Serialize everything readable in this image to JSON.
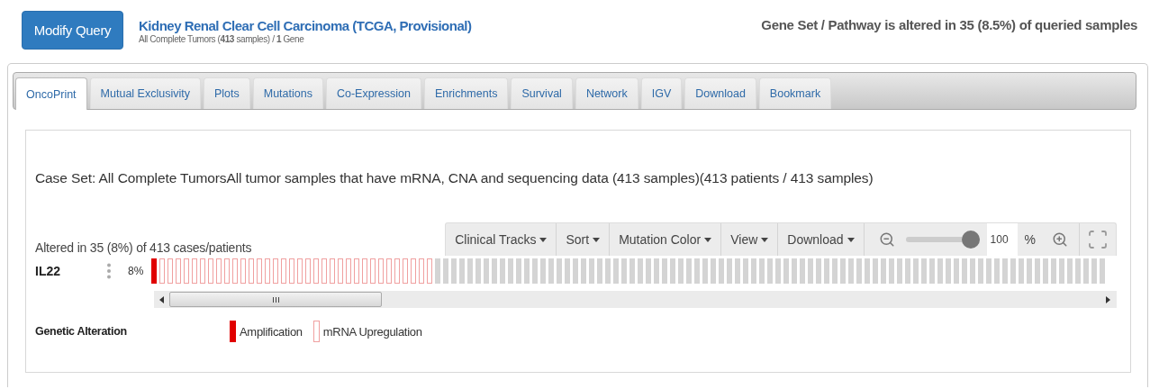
{
  "header": {
    "modify_button": "Modify Query",
    "study_title": "Kidney Renal Clear Cell Carcinoma (TCGA, Provisional)",
    "study_subtitle": "All Complete Tumors (**413** samples) / **1** Gene",
    "altered_summary": "Gene Set / Pathway is altered in 35 (8.5%) of queried samples"
  },
  "tabs": [
    {
      "label": "OncoPrint",
      "selected": true
    },
    {
      "label": "Mutual Exclusivity",
      "selected": false
    },
    {
      "label": "Plots",
      "selected": false
    },
    {
      "label": "Mutations",
      "selected": false
    },
    {
      "label": "Co-Expression",
      "selected": false
    },
    {
      "label": "Enrichments",
      "selected": false
    },
    {
      "label": "Survival",
      "selected": false
    },
    {
      "label": "Network",
      "selected": false
    },
    {
      "label": "IGV",
      "selected": false
    },
    {
      "label": "Download",
      "selected": false
    },
    {
      "label": "Bookmark",
      "selected": false
    }
  ],
  "case_set": "Case Set: All Complete TumorsAll tumor samples that have mRNA, CNA and sequencing data (413 samples)(413 patients / 413 samples)",
  "oncoprint": {
    "altered_text": "Altered in 35 (8%) of 413 cases/patients",
    "toolbar": {
      "menus": [
        "Clinical Tracks",
        "Sort",
        "Mutation Color",
        "View",
        "Download"
      ],
      "zoom": {
        "level": 1,
        "value": "100",
        "unit": "%"
      }
    },
    "track": {
      "gene": "IL22",
      "percent": "8%",
      "cells": [
        {
          "kind": "amp"
        },
        {
          "kind": "mrna_up"
        },
        {
          "kind": "mrna_up"
        },
        {
          "kind": "mrna_up"
        },
        {
          "kind": "mrna_up"
        },
        {
          "kind": "mrna_up"
        },
        {
          "kind": "mrna_up"
        },
        {
          "kind": "mrna_up"
        },
        {
          "kind": "mrna_up"
        },
        {
          "kind": "mrna_up"
        },
        {
          "kind": "mrna_up"
        },
        {
          "kind": "mrna_up"
        },
        {
          "kind": "mrna_up"
        },
        {
          "kind": "mrna_up"
        },
        {
          "kind": "mrna_up"
        },
        {
          "kind": "mrna_up"
        },
        {
          "kind": "mrna_up"
        },
        {
          "kind": "mrna_up"
        },
        {
          "kind": "mrna_up"
        },
        {
          "kind": "mrna_up"
        },
        {
          "kind": "mrna_up"
        },
        {
          "kind": "mrna_up"
        },
        {
          "kind": "mrna_up"
        },
        {
          "kind": "mrna_up"
        },
        {
          "kind": "mrna_up"
        },
        {
          "kind": "mrna_up"
        },
        {
          "kind": "mrna_up"
        },
        {
          "kind": "mrna_up"
        },
        {
          "kind": "mrna_up"
        },
        {
          "kind": "mrna_up"
        },
        {
          "kind": "mrna_up"
        },
        {
          "kind": "mrna_up"
        },
        {
          "kind": "mrna_up"
        },
        {
          "kind": "mrna_up"
        },
        {
          "kind": "mrna_up"
        },
        {
          "kind": "none"
        },
        {
          "kind": "none"
        },
        {
          "kind": "none"
        },
        {
          "kind": "none"
        },
        {
          "kind": "none"
        },
        {
          "kind": "none"
        },
        {
          "kind": "none"
        },
        {
          "kind": "none"
        },
        {
          "kind": "none"
        },
        {
          "kind": "none"
        },
        {
          "kind": "none"
        },
        {
          "kind": "none"
        },
        {
          "kind": "none"
        },
        {
          "kind": "none"
        },
        {
          "kind": "none"
        },
        {
          "kind": "none"
        },
        {
          "kind": "none"
        },
        {
          "kind": "none"
        },
        {
          "kind": "none"
        },
        {
          "kind": "none"
        },
        {
          "kind": "none"
        },
        {
          "kind": "none"
        },
        {
          "kind": "none"
        },
        {
          "kind": "none"
        },
        {
          "kind": "none"
        },
        {
          "kind": "none"
        },
        {
          "kind": "none"
        },
        {
          "kind": "none"
        },
        {
          "kind": "none"
        },
        {
          "kind": "none"
        },
        {
          "kind": "none"
        },
        {
          "kind": "none"
        },
        {
          "kind": "none"
        },
        {
          "kind": "none"
        },
        {
          "kind": "none"
        },
        {
          "kind": "none"
        },
        {
          "kind": "none"
        },
        {
          "kind": "none"
        },
        {
          "kind": "none"
        },
        {
          "kind": "none"
        },
        {
          "kind": "none"
        },
        {
          "kind": "none"
        },
        {
          "kind": "none"
        },
        {
          "kind": "none"
        },
        {
          "kind": "none"
        },
        {
          "kind": "none"
        },
        {
          "kind": "none"
        },
        {
          "kind": "none"
        },
        {
          "kind": "none"
        },
        {
          "kind": "none"
        },
        {
          "kind": "none"
        },
        {
          "kind": "none"
        },
        {
          "kind": "none"
        },
        {
          "kind": "none"
        },
        {
          "kind": "none"
        },
        {
          "kind": "none"
        },
        {
          "kind": "none"
        },
        {
          "kind": "none"
        },
        {
          "kind": "none"
        },
        {
          "kind": "none"
        },
        {
          "kind": "none"
        },
        {
          "kind": "none"
        },
        {
          "kind": "none"
        },
        {
          "kind": "none"
        },
        {
          "kind": "none"
        },
        {
          "kind": "none"
        },
        {
          "kind": "none"
        },
        {
          "kind": "none"
        },
        {
          "kind": "none"
        },
        {
          "kind": "none"
        },
        {
          "kind": "none"
        },
        {
          "kind": "none"
        },
        {
          "kind": "none"
        },
        {
          "kind": "none"
        },
        {
          "kind": "none"
        },
        {
          "kind": "none"
        },
        {
          "kind": "none"
        },
        {
          "kind": "none"
        },
        {
          "kind": "none"
        },
        {
          "kind": "none"
        },
        {
          "kind": "none"
        },
        {
          "kind": "none"
        },
        {
          "kind": "none"
        }
      ]
    },
    "legend": {
      "title": "Genetic Alteration",
      "items": [
        {
          "kind": "amp",
          "label": "Amplification"
        },
        {
          "kind": "mrna_up",
          "label": "mRNA Upregulation"
        }
      ]
    }
  }
}
